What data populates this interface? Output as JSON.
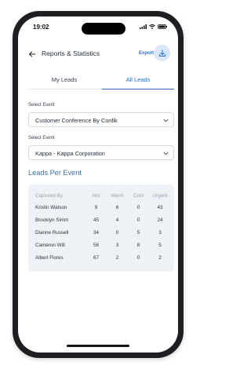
{
  "status_bar": {
    "time": "19:02"
  },
  "header": {
    "title": "Reports & Statistics",
    "export_label": "Export"
  },
  "tabs": [
    {
      "label": "My Leads",
      "active": false
    },
    {
      "label": "All Leads",
      "active": true
    }
  ],
  "select_event": {
    "label": "Select Event",
    "value": "Customer Conference By Confik"
  },
  "select_company": {
    "label": "Select Event",
    "value": "Kappa - Kappa Corporation"
  },
  "section_title": "Leads Per Event",
  "table": {
    "columns": [
      "Captured By",
      "Hot",
      "Warm",
      "Cold",
      "Urgent"
    ],
    "rows": [
      [
        "Kristin Watson",
        "9",
        "6",
        "0",
        "43"
      ],
      [
        "Brooklyn Simm",
        "45",
        "4",
        "0",
        "24"
      ],
      [
        "Dianne Russell",
        "34",
        "0",
        "5",
        "3"
      ],
      [
        "Cameron Will",
        "56",
        "3",
        "8",
        "5"
      ],
      [
        "Albert Flores",
        "67",
        "2",
        "0",
        "2"
      ]
    ]
  },
  "colors": {
    "accent": "#2a6fc4",
    "section_title": "#3d6fa8",
    "table_bg": "#eef1f5",
    "export_button_bg": "#d9e7f8"
  }
}
